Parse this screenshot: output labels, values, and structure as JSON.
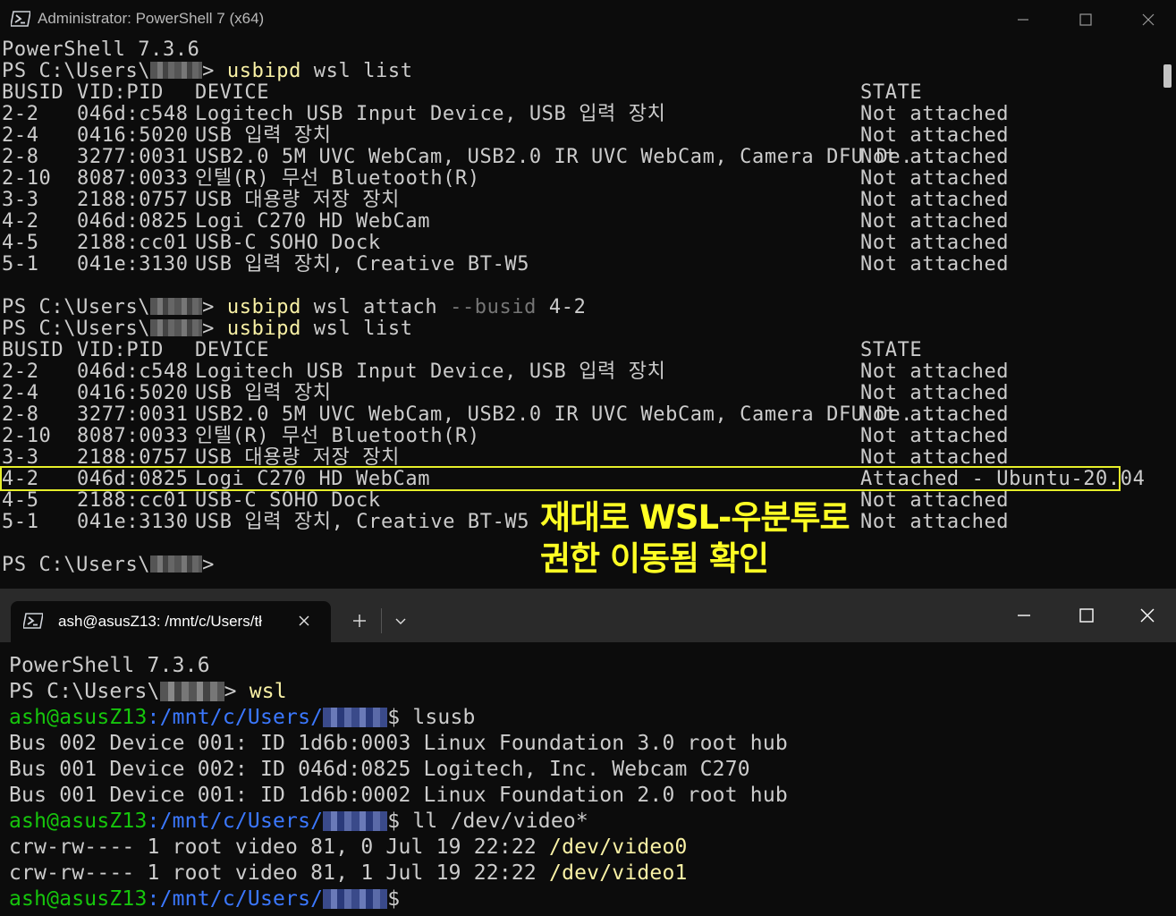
{
  "colors": {
    "background": "#0c0c0c",
    "text": "#cccccc",
    "command": "#f9f1a5",
    "parameter": "#767676",
    "prompt_green": "#16c60c",
    "path_blue": "#3b78ff",
    "highlight_box": "#e6ee2a",
    "annotation": "#ffff24"
  },
  "top_window": {
    "title": "Administrator: PowerShell 7 (x64)",
    "icons": [
      "powershell-icon",
      "minimize-icon",
      "maximize-icon",
      "close-icon"
    ],
    "version_line": "PowerShell 7.3.6",
    "prompt_prefix": "PS C:\\Users\\",
    "prompt_suffix": ">",
    "cmd1": {
      "exe": "usbipd",
      "args": " wsl list"
    },
    "cmd2": {
      "exe": "usbipd",
      "args1": " wsl attach ",
      "param": "--busid",
      "args2": " 4-2"
    },
    "cmd3": {
      "exe": "usbipd",
      "args": " wsl list"
    },
    "headers": {
      "busid": "BUSID",
      "vidpid": "VID:PID",
      "device": "DEVICE",
      "state": "STATE"
    },
    "list1": [
      {
        "busid": "2-2",
        "vidpid": "046d:c548",
        "device": "Logitech USB Input Device, USB 입력 장치",
        "state": "Not attached"
      },
      {
        "busid": "2-4",
        "vidpid": "0416:5020",
        "device": "USB 입력 장치",
        "state": "Not attached"
      },
      {
        "busid": "2-8",
        "vidpid": "3277:0031",
        "device": "USB2.0 5M UVC WebCam, USB2.0 IR UVC WebCam, Camera DFU De...",
        "state": "Not attached"
      },
      {
        "busid": "2-10",
        "vidpid": "8087:0033",
        "device": "인텔(R) 무선 Bluetooth(R)",
        "state": "Not attached"
      },
      {
        "busid": "3-3",
        "vidpid": "2188:0757",
        "device": "USB 대용량 저장 장치",
        "state": "Not attached"
      },
      {
        "busid": "4-2",
        "vidpid": "046d:0825",
        "device": "Logi C270 HD WebCam",
        "state": "Not attached"
      },
      {
        "busid": "4-5",
        "vidpid": "2188:cc01",
        "device": "USB-C SOHO Dock",
        "state": "Not attached"
      },
      {
        "busid": "5-1",
        "vidpid": "041e:3130",
        "device": "USB 입력 장치, Creative BT-W5",
        "state": "Not attached"
      }
    ],
    "list2": [
      {
        "busid": "2-2",
        "vidpid": "046d:c548",
        "device": "Logitech USB Input Device, USB 입력 장치",
        "state": "Not attached"
      },
      {
        "busid": "2-4",
        "vidpid": "0416:5020",
        "device": "USB 입력 장치",
        "state": "Not attached"
      },
      {
        "busid": "2-8",
        "vidpid": "3277:0031",
        "device": "USB2.0 5M UVC WebCam, USB2.0 IR UVC WebCam, Camera DFU De...",
        "state": "Not attached"
      },
      {
        "busid": "2-10",
        "vidpid": "8087:0033",
        "device": "인텔(R) 무선 Bluetooth(R)",
        "state": "Not attached"
      },
      {
        "busid": "3-3",
        "vidpid": "2188:0757",
        "device": "USB 대용량 저장 장치",
        "state": "Not attached"
      },
      {
        "busid": "4-2",
        "vidpid": "046d:0825",
        "device": "Logi C270 HD WebCam",
        "state": "Attached - Ubuntu-20.04"
      },
      {
        "busid": "4-5",
        "vidpid": "2188:cc01",
        "device": "USB-C SOHO Dock",
        "state": "Not attached"
      },
      {
        "busid": "5-1",
        "vidpid": "041e:3130",
        "device": "USB 입력 장치, Creative BT-W5",
        "state": "Not attached"
      }
    ],
    "annotation": "재대로 WSL-우분투로\n권한 이동됨 확인"
  },
  "bottom_window": {
    "tab_title": "ash@asusZ13: /mnt/c/Users/tł",
    "icons": [
      "powershell-icon",
      "tab-close-icon",
      "plus-icon",
      "chevron-down-icon",
      "minimize-icon",
      "maximize-icon",
      "close-icon"
    ],
    "version_line": "PowerShell 7.3.6",
    "ps_prefix": "PS C:\\Users\\",
    "ps_suffix": "> ",
    "ps_cmd": "wsl",
    "bash_user": "ash@asusZ13",
    "bash_path": ":/mnt/c/Users/",
    "bash_dollar": "$ ",
    "cmd_lsusb": "lsusb",
    "lsusb_out": [
      "Bus 002 Device 001: ID 1d6b:0003 Linux Foundation 3.0 root hub",
      "Bus 001 Device 002: ID 046d:0825 Logitech, Inc. Webcam C270",
      "Bus 001 Device 001: ID 1d6b:0002 Linux Foundation 2.0 root hub"
    ],
    "cmd_ll": "ll /dev/video*",
    "ll_out": [
      {
        "meta": "crw-rw---- 1 root video 81, 0 Jul 19 22:22 ",
        "file": "/dev/video0"
      },
      {
        "meta": "crw-rw---- 1 root video 81, 1 Jul 19 22:22 ",
        "file": "/dev/video1"
      }
    ]
  }
}
